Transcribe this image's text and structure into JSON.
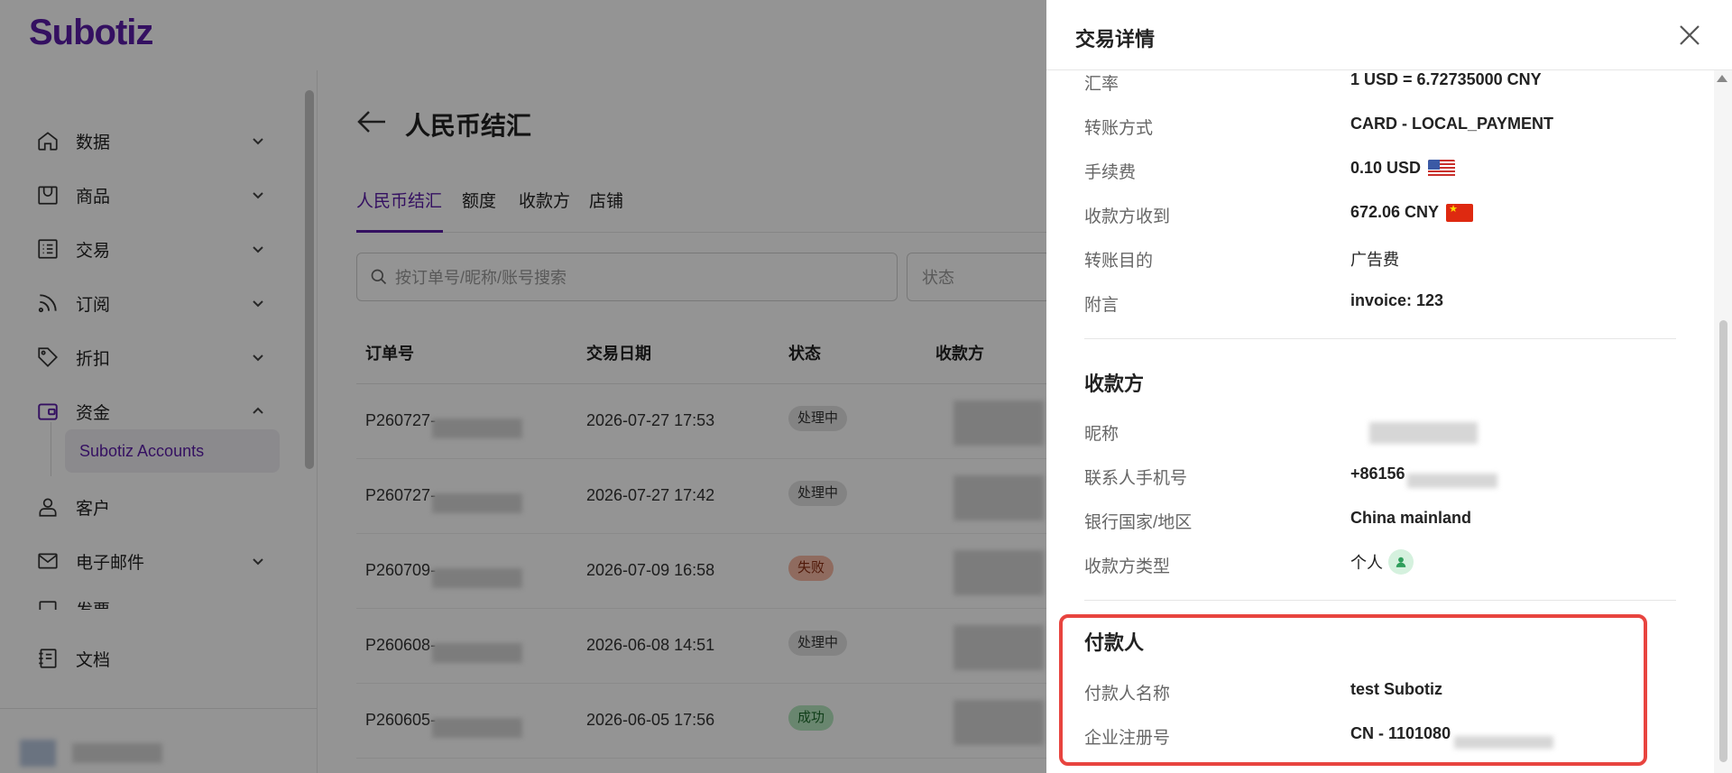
{
  "app": {
    "logo": "Subotiz"
  },
  "sidebar": {
    "items": [
      {
        "label": "数据"
      },
      {
        "label": "商品"
      },
      {
        "label": "交易"
      },
      {
        "label": "订阅"
      },
      {
        "label": "折扣"
      },
      {
        "label": "资金"
      },
      {
        "label": "客户"
      },
      {
        "label": "电子邮件"
      },
      {
        "label": "发票"
      }
    ],
    "sub_item": "Subotiz Accounts",
    "docs": "文档"
  },
  "main": {
    "title": "人民币结汇",
    "tabs": [
      "人民币结汇",
      "额度",
      "收款方",
      "店铺"
    ],
    "search_placeholder": "按订单号/昵称/账号搜索",
    "status_placeholder": "状态",
    "columns": [
      "订单号",
      "交易日期",
      "状态",
      "收款方"
    ],
    "rows": [
      {
        "order": "P260727-",
        "date": "2026-07-27 17:53",
        "status": "处理中"
      },
      {
        "order": "P260727-",
        "date": "2026-07-27 17:42",
        "status": "处理中"
      },
      {
        "order": "P260709-",
        "date": "2026-07-09 16:58",
        "status": "失败"
      },
      {
        "order": "P260608-",
        "date": "2026-06-08 14:51",
        "status": "处理中"
      },
      {
        "order": "P260605-",
        "date": "2026-06-05 17:56",
        "status": "成功"
      }
    ]
  },
  "drawer": {
    "title": "交易详情",
    "fields_top": [
      {
        "label": "汇率",
        "value": "1 USD = 6.72735000 CNY"
      },
      {
        "label": "转账方式",
        "value": "CARD - LOCAL_PAYMENT"
      },
      {
        "label": "手续费",
        "value": "0.10 USD"
      },
      {
        "label": "收款方收到",
        "value": "672.06 CNY"
      },
      {
        "label": "转账目的",
        "value": "广告费"
      },
      {
        "label": "附言",
        "value": "invoice: 123"
      }
    ],
    "payee_section": "收款方",
    "payee_fields": [
      {
        "label": "昵称",
        "value": ""
      },
      {
        "label": "联系人手机号",
        "value": "+86156"
      },
      {
        "label": "银行国家/地区",
        "value": "China mainland"
      },
      {
        "label": "收款方类型",
        "value": "个人"
      }
    ],
    "payer_section": "付款人",
    "payer_fields": [
      {
        "label": "付款人名称",
        "value": "test Subotiz"
      },
      {
        "label": "企业注册号",
        "value": "CN - 1101080"
      }
    ]
  },
  "colors": {
    "brand": "#5b1ca8",
    "highlight": "#e8443f"
  }
}
